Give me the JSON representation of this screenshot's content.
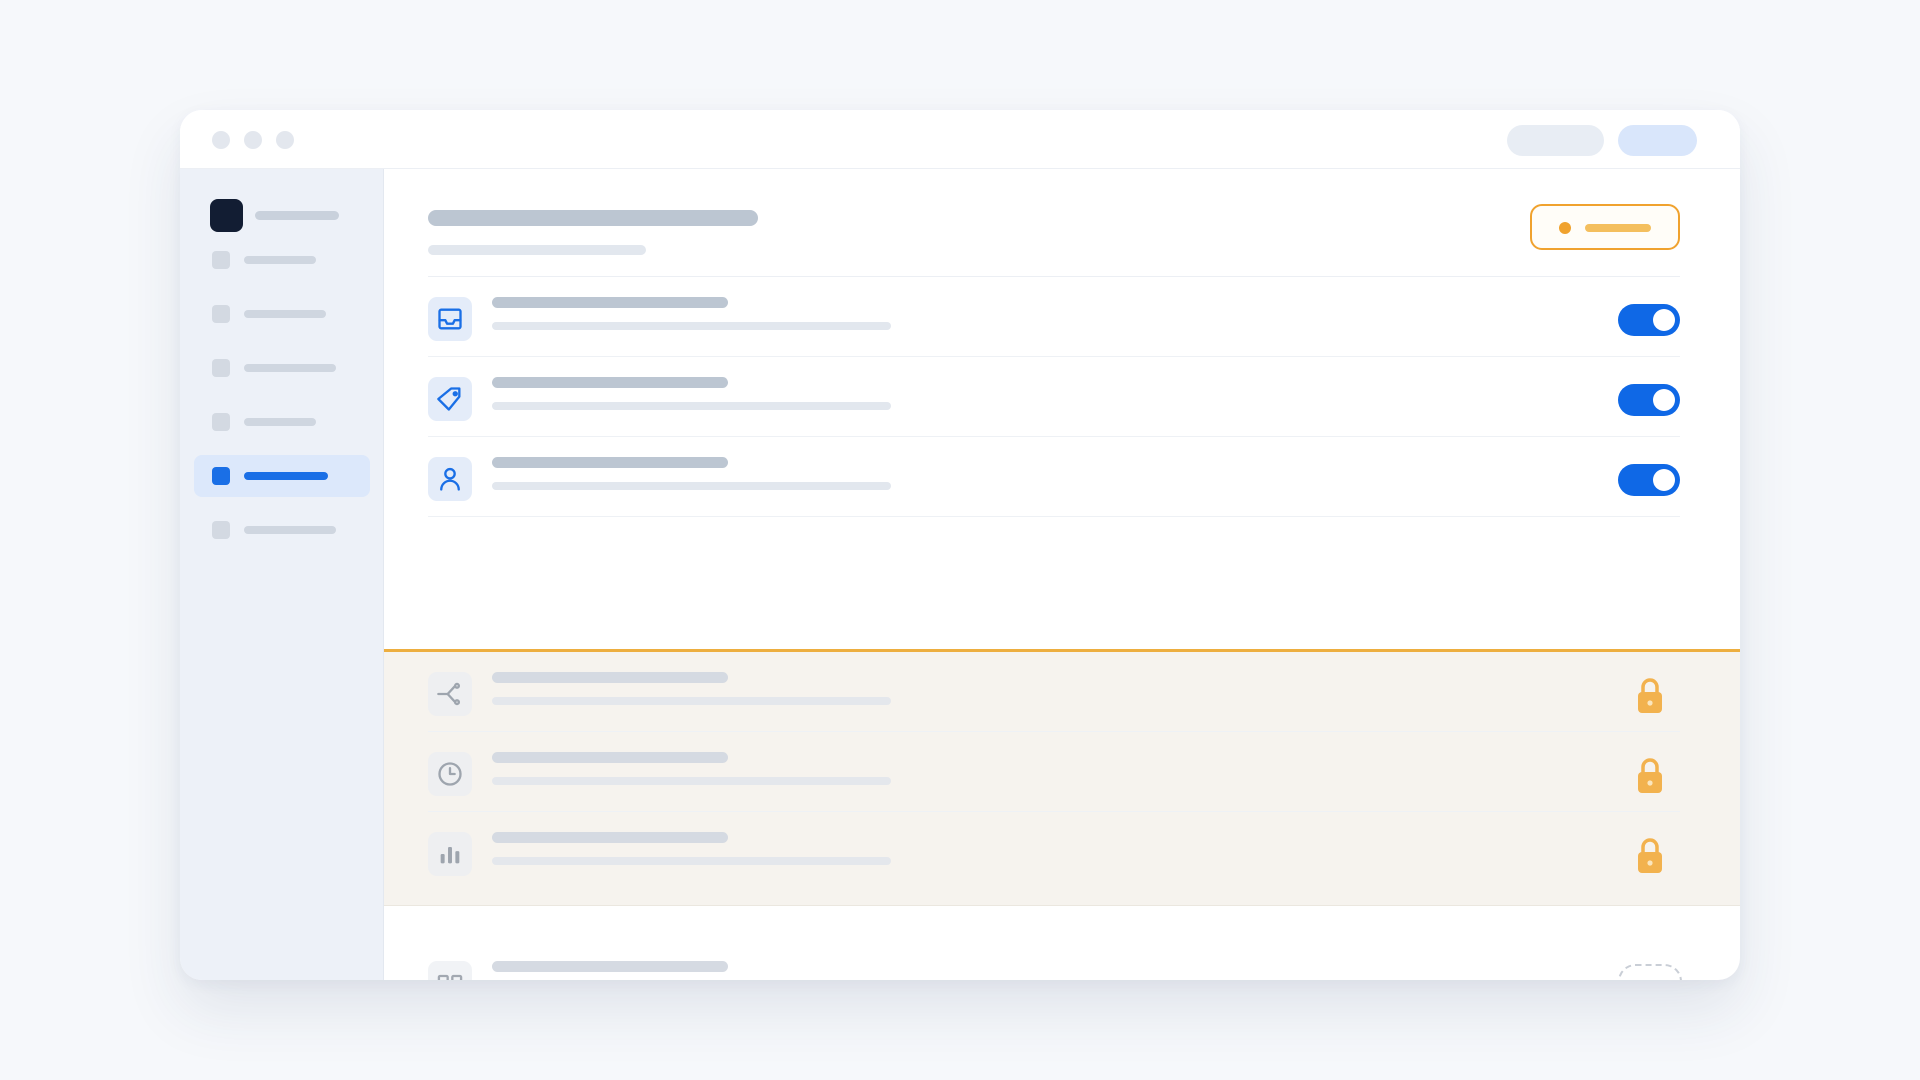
{
  "window": {
    "traffic_lights": [
      "window-dot",
      "window-dot",
      "window-dot"
    ],
    "toolbar_buttons": [
      {
        "name": "toolbar-button-secondary",
        "color": "#e8edf4"
      },
      {
        "name": "toolbar-button-primary",
        "color": "#d9e6fb"
      }
    ]
  },
  "sidebar": {
    "logo": {
      "icon": "app-logo",
      "color": "#121d33"
    },
    "items": [
      {
        "name": "sidebar-item-1",
        "active": false
      },
      {
        "name": "sidebar-item-2",
        "active": false
      },
      {
        "name": "sidebar-item-3",
        "active": false
      },
      {
        "name": "sidebar-item-4",
        "active": false
      },
      {
        "name": "sidebar-item-5",
        "active": true
      },
      {
        "name": "sidebar-item-6",
        "active": false
      }
    ]
  },
  "header": {
    "upgrade_badge": {
      "icon": "status-dot",
      "color": "#f0a22e"
    }
  },
  "features": {
    "enabled": [
      {
        "icon": "inbox-icon",
        "state": "on"
      },
      {
        "icon": "tag-icon",
        "state": "on"
      },
      {
        "icon": "user-icon",
        "state": "on"
      }
    ],
    "locked": [
      {
        "icon": "branch-icon",
        "state": "locked"
      },
      {
        "icon": "clock-icon",
        "state": "locked"
      },
      {
        "icon": "bar-chart-icon",
        "state": "locked"
      }
    ],
    "available": [
      {
        "icon": "columns-icon",
        "state": "empty-slot"
      }
    ]
  },
  "colors": {
    "accent": "#0f68e6",
    "locked_accent": "#f0a22e",
    "locked_background": "#f6f3ee",
    "sidebar_background": "#edf1f8"
  }
}
